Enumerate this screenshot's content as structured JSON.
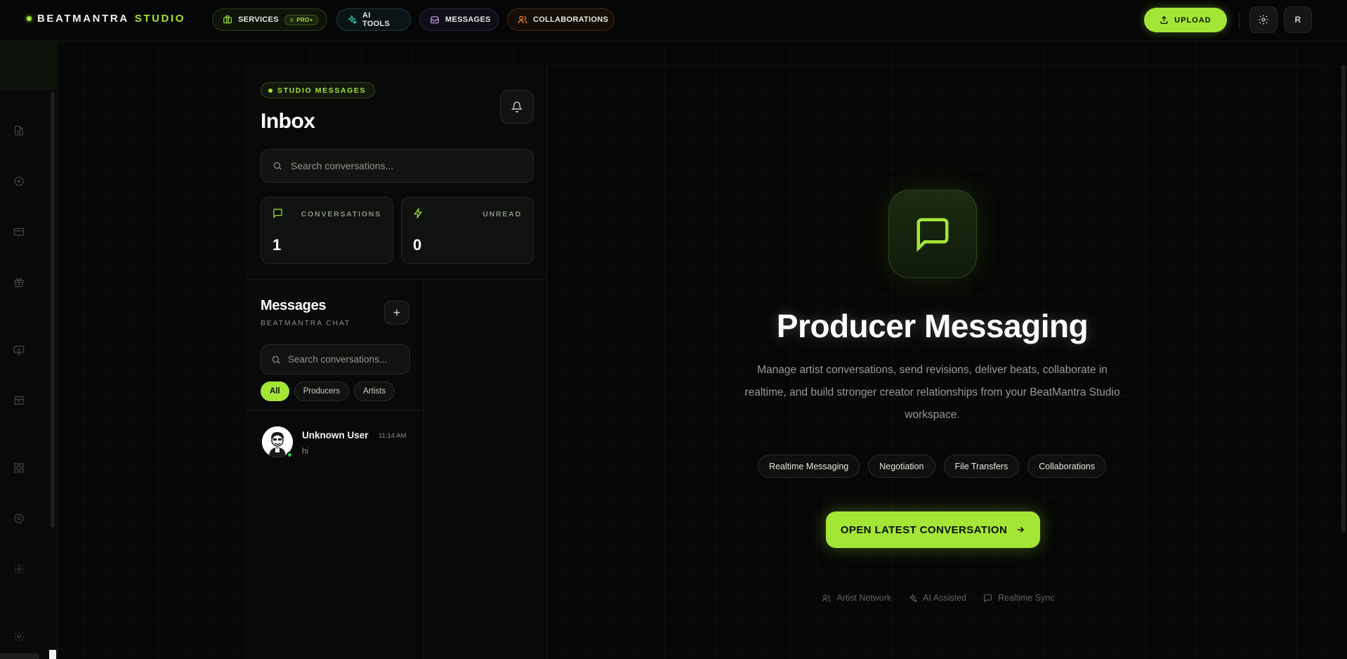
{
  "brand": {
    "name_part1": "BEATMANTRA",
    "name_part2": "STUDIO"
  },
  "nav": {
    "services": "SERVICES",
    "pro_badge": "PRO+",
    "ai_tools": "AI TOOLS",
    "messages": "MESSAGES",
    "collaborations": "COLLABORATIONS",
    "upload": "UPLOAD",
    "avatar_initial": "R"
  },
  "inbox": {
    "tag": "STUDIO MESSAGES",
    "title": "Inbox",
    "search_placeholder": "Search conversations...",
    "stats": {
      "conversations_label": "CONVERSATIONS",
      "conversations_value": "1",
      "unread_label": "UNREAD",
      "unread_value": "0"
    }
  },
  "messages": {
    "title": "Messages",
    "subtitle": "BEATMANTRA CHAT",
    "add_label": "+",
    "search_placeholder": "Search conversations...",
    "filters": [
      "All",
      "Producers",
      "Artists"
    ],
    "active_filter": "All",
    "conversations": [
      {
        "name": "Unknown User",
        "time": "11:14 AM",
        "preview": "hi",
        "online": true
      }
    ]
  },
  "hero": {
    "title": "Producer Messaging",
    "description": "Manage artist conversations, send revisions, deliver beats, collaborate in realtime, and build stronger creator relationships from your BeatMantra Studio workspace.",
    "features": [
      "Realtime Messaging",
      "Negotiation",
      "File Transfers",
      "Collaborations"
    ],
    "cta": "OPEN LATEST CONVERSATION",
    "footer": [
      "Artist Network",
      "AI Assisted",
      "Realtime Sync"
    ]
  },
  "colors": {
    "accent": "#a3e635",
    "background": "#060706",
    "online": "#22c55e"
  },
  "icons": {
    "rail": [
      "document-icon",
      "disc-icon",
      "card-icon",
      "gift-icon",
      "monitor-icon",
      "archive-icon",
      "grid-icon",
      "disc-icon",
      "gear-icon",
      "gear-icon"
    ]
  }
}
